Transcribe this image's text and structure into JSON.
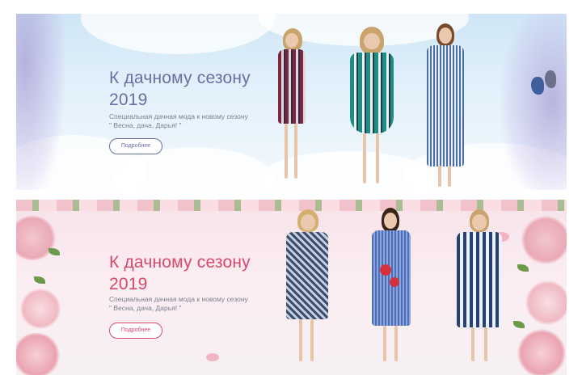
{
  "banners": [
    {
      "title_line1": "К дачному сезону",
      "title_line2": "2019",
      "subtitle_line1": "Специальная дачная мода к новому сезону",
      "subtitle_line2": "\" Весна, дача, Дарья! \"",
      "button_label": "Подробнее",
      "accent_color": "#6a6fa3"
    },
    {
      "title_line1": "К дачному сезону",
      "title_line2": "2019",
      "subtitle_line1": "Специальная дачная мода к новому сезону",
      "subtitle_line2": "\" Весна, дача, Дарья! \"",
      "button_label": "Подробнее",
      "accent_color": "#d84a6b"
    }
  ]
}
